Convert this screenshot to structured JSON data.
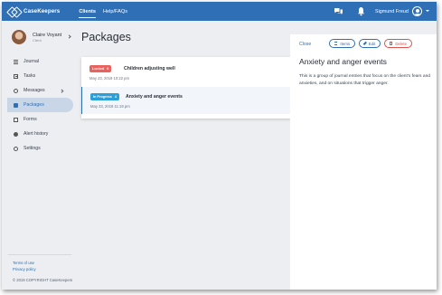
{
  "app": {
    "name": "CaseKeepers"
  },
  "nav": {
    "items": [
      {
        "label": "Clients",
        "active": true
      },
      {
        "label": "Help/FAQs",
        "active": false
      }
    ]
  },
  "header": {
    "user_name": "Sigmund Freud",
    "icons": [
      "chat-icon",
      "bell-icon",
      "user-avatar-icon",
      "chevron-down-icon"
    ]
  },
  "profile": {
    "name": "Claire Voyant",
    "role": "Client"
  },
  "sidebar": {
    "items": [
      {
        "label": "Journal",
        "icon": "journal-icon"
      },
      {
        "label": "Tasks",
        "icon": "tasks-icon"
      },
      {
        "label": "Messages",
        "icon": "messages-icon"
      },
      {
        "label": "Packages",
        "icon": "packages-icon",
        "active": true
      },
      {
        "label": "Forms",
        "icon": "forms-icon"
      },
      {
        "label": "Alert history",
        "icon": "alert-icon"
      },
      {
        "label": "Settings",
        "icon": "settings-icon"
      }
    ],
    "footer": {
      "terms": "Terms of use",
      "privacy": "Privacy policy",
      "copyright": "© 2019 COPYRIGHT CaseKeepers"
    }
  },
  "page": {
    "title": "Packages"
  },
  "packages": [
    {
      "status": "Locked",
      "count": "6",
      "title": "Children adjusting well",
      "date": "May 23, 2019 10:22 pm"
    },
    {
      "status": "In Progress",
      "count": "4",
      "title": "Anxiety and anger events",
      "date": "May 23, 2019 11:19 pm"
    }
  ],
  "detail": {
    "close_label": "Close",
    "items_label": "Items",
    "edit_label": "Edit",
    "delete_label": "Delete",
    "title": "Anxiety and anger events",
    "description": "This is a group of journal entries that focus on the client's fears and anxieties, and on situations that trigger anger."
  },
  "colors": {
    "brand": "#2f6fb6",
    "locked": "#e8625e",
    "in_progress": "#2a9fd8",
    "delete": "#e0504b"
  }
}
